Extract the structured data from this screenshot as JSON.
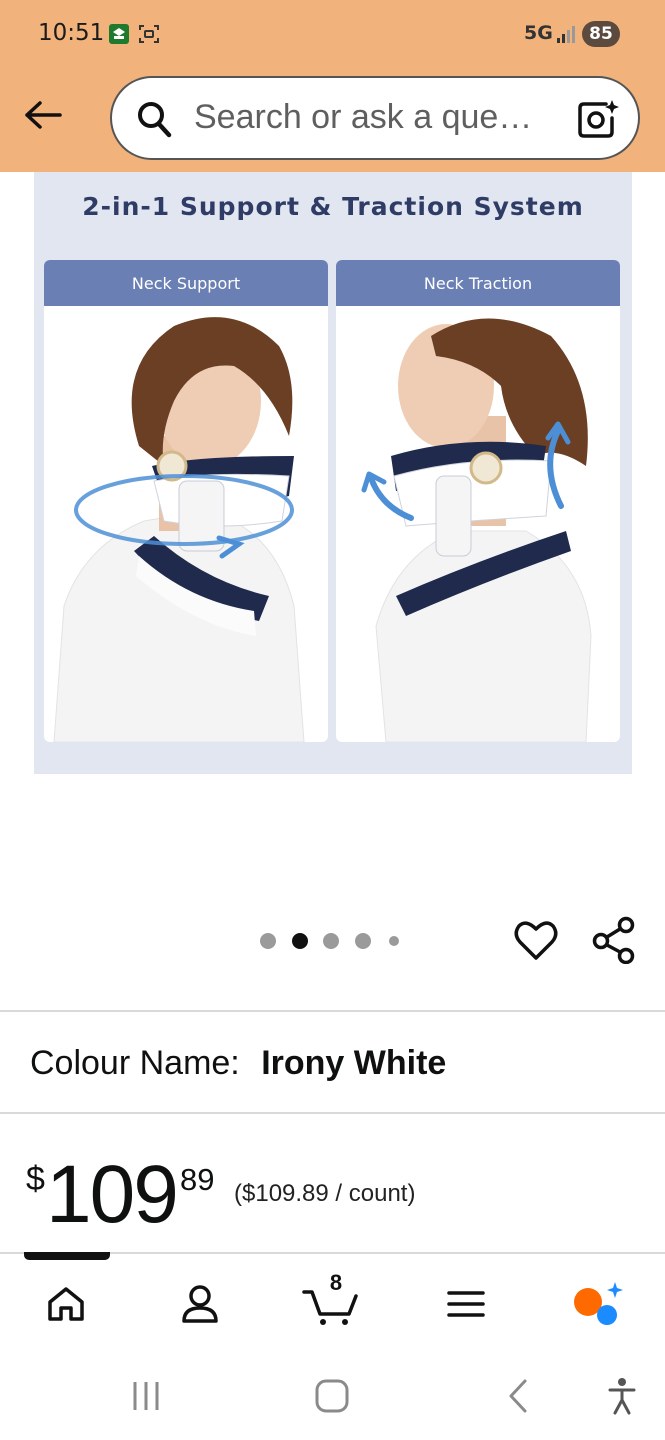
{
  "status_bar": {
    "time": "10:51",
    "network": "5G",
    "battery": "85"
  },
  "search": {
    "placeholder": "Search or ask a que…",
    "back_icon": "arrow-left-icon",
    "search_icon": "search-icon",
    "camera_icon": "camera-lens-icon"
  },
  "product_image": {
    "title": "2-in-1 Support & Traction System",
    "panels": [
      {
        "label": "Neck Support"
      },
      {
        "label": "Neck Traction"
      }
    ]
  },
  "carousel": {
    "total_dots": 5,
    "active_index": 1
  },
  "colour": {
    "label": "Colour Name:",
    "value": "Irony White"
  },
  "price": {
    "symbol": "$",
    "whole": "109",
    "fraction": "89",
    "unit_price": "($109.89 / count)"
  },
  "bottom_nav": {
    "items": [
      "home-icon",
      "account-icon",
      "cart-icon",
      "menu-icon",
      "rufus-icon"
    ],
    "cart_count": "8",
    "accent_orange": "#ff6a00",
    "accent_blue": "#1a8cff"
  },
  "colors": {
    "header_bg": "#f2b27b",
    "image_bg": "#e1e6f1",
    "panel_header": "#6a7fb4",
    "title_text": "#2f3d66"
  }
}
